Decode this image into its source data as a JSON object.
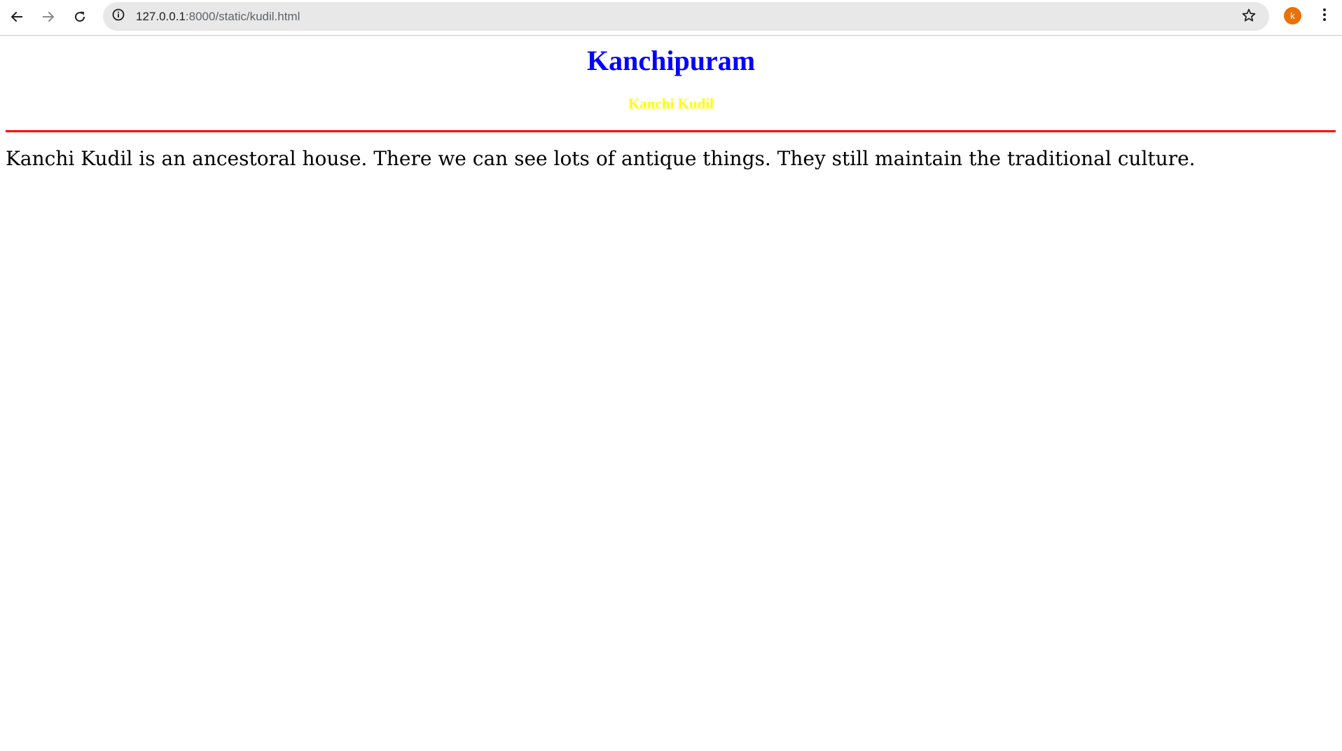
{
  "browser": {
    "url_host": "127.0.0.1",
    "url_path": ":8000/static/kudil.html",
    "profile_initial": "k",
    "accent_color": "#e8710a"
  },
  "icons": {
    "back": "arrow-left-icon",
    "forward": "arrow-right-icon",
    "reload": "reload-icon",
    "site_info": "info-icon",
    "bookmark": "star-icon",
    "menu": "kebab-menu-icon"
  },
  "page": {
    "title": "Kanchipuram",
    "subtitle": "Kanchi Kudil",
    "body": "Kanchi Kudil is an ancestoral house. There we can see lots of antique things. They still maintain the traditional culture.",
    "title_color": "#0000ff",
    "subtitle_color": "#ffff00",
    "divider_color": "#ff0000"
  }
}
